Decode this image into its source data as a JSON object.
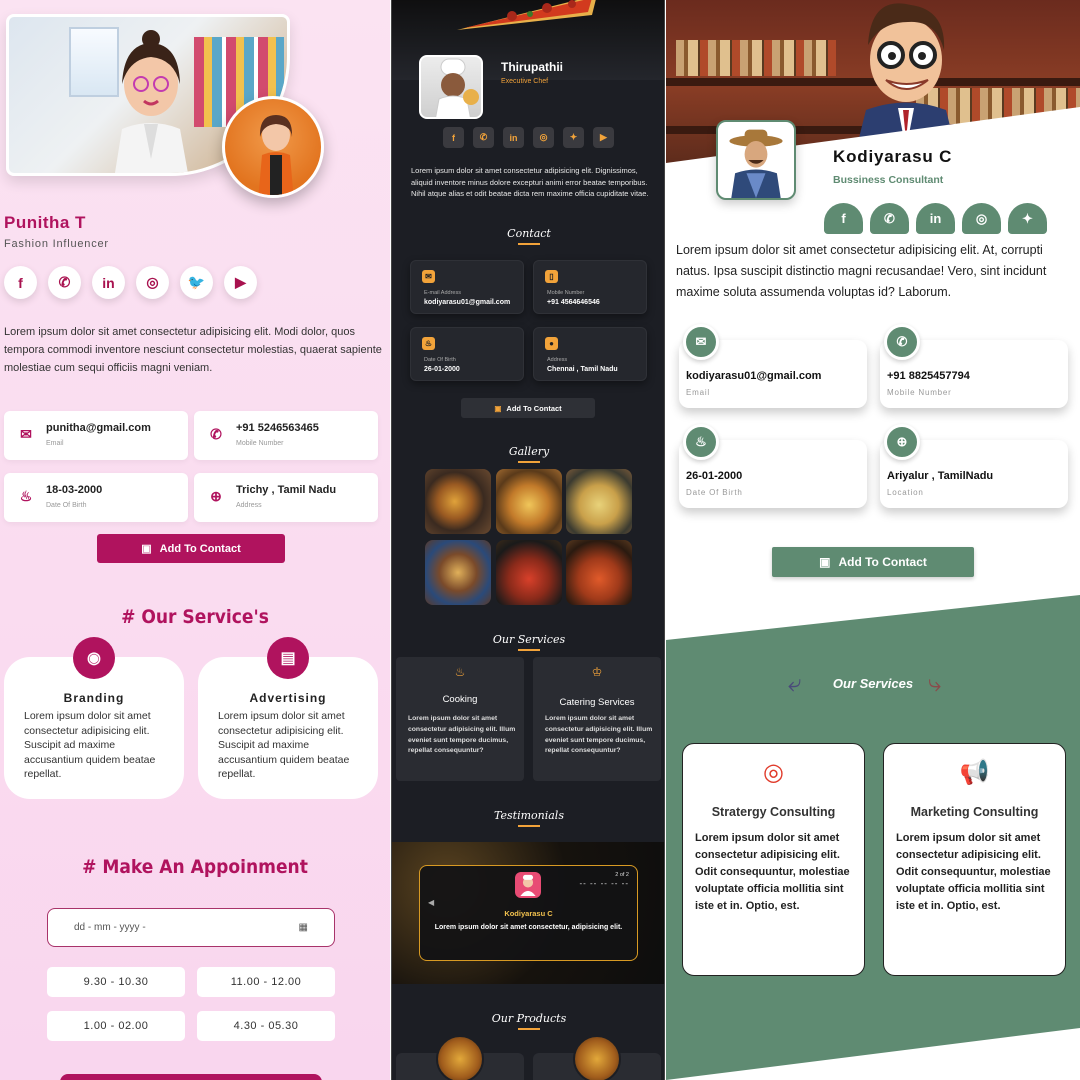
{
  "panel1": {
    "name": "Punitha T",
    "role": "Fashion Influencer",
    "socials": [
      "f",
      "whatsapp",
      "in",
      "instagram",
      "twitter",
      "youtube"
    ],
    "about": "Lorem ipsum dolor sit amet consectetur adipisicing elit. Modi dolor, quos tempora commodi inventore nesciunt consectetur molestias, quaerat sapiente molestiae cum sequi officiis magni veniam.",
    "contacts": [
      {
        "value": "punitha@gmail.com",
        "label": "Email",
        "icon": "mail-icon"
      },
      {
        "value": "+91 5246563465",
        "label": "Mobile Number",
        "icon": "phone-icon"
      },
      {
        "value": "18-03-2000",
        "label": "Date Of Birth",
        "icon": "cake-icon"
      },
      {
        "value": "Trichy , Tamil Nadu",
        "label": "Address",
        "icon": "location-icon"
      }
    ],
    "add_contact": "Add To Contact",
    "services_heading": "# Our Service's",
    "services": [
      {
        "title": "Branding",
        "desc": "Lorem ipsum dolor sit amet consectetur adipisicing elit. Suscipit ad maxime accusantium quidem beatae repellat."
      },
      {
        "title": "Advertising",
        "desc": "Lorem ipsum dolor sit amet consectetur adipisicing elit. Suscipit ad maxime accusantium quidem beatae repellat."
      }
    ],
    "appointment_heading": "# Make An Appoinment",
    "date_placeholder": "dd - mm - yyyy -",
    "slots": [
      "9.30 - 10.30",
      "11.00 - 12.00",
      "1.00 - 02.00",
      "4.30 - 05.30"
    ],
    "accent": "#b0135e"
  },
  "panel2": {
    "name": "Thirupathii",
    "role": "Executive Chef",
    "about": "Lorem ipsum dolor sit amet consectetur adipisicing elit. Dignissimos, aliquid inventore minus dolore excepturi animi error beatae temporibus. Nihil atque alias et odit beatae dicta rem maxime officia cupiditate vitae.",
    "contact_heading": "Contact",
    "contacts": [
      {
        "label": "E-mail Address",
        "value": "kodiyarasu01@gmail.com"
      },
      {
        "label": "Mobile Number",
        "value": "+91 4564646546"
      },
      {
        "label": "Date Of Birth",
        "value": "26-01-2000"
      },
      {
        "label": "Address",
        "value": "Chennai , Tamil Nadu"
      }
    ],
    "add_contact": "Add To Contact",
    "gallery_heading": "Gallery",
    "services_heading": "Our Services",
    "services": [
      {
        "title": "Cooking",
        "desc": "Lorem ipsum dolor sit amet consectetur adipisicing elit. Illum eveniet sunt tempore ducimus, repellat consequuntur?"
      },
      {
        "title": "Catering Services",
        "desc": "Lorem ipsum dolor sit amet consectetur adipisicing elit. Illum eveniet sunt tempore ducimus, repellat consequuntur?"
      }
    ],
    "testimonials_heading": "Testimonials",
    "testimonial": {
      "page": "2 of 2",
      "stars": "-- -- -- -- --",
      "name": "Kodiyarasu C",
      "quote": "Lorem ipsum dolor sit amet consectetur, adipisicing elit."
    },
    "products_heading": "Our Products",
    "accent": "#f2a33a"
  },
  "panel3": {
    "name": "Kodiyarasu C",
    "role": "Bussiness Consultant",
    "about": "Lorem ipsum dolor sit amet consectetur adipisicing elit. At, corrupti natus. Ipsa suscipit distinctio magni recusandae! Vero, sint incidunt maxime soluta assumenda voluptas id? Laborum.",
    "contacts": [
      {
        "value": "kodiyarasu01@gmail.com",
        "label": "Email"
      },
      {
        "value": "+91 8825457794",
        "label": "Mobile Number"
      },
      {
        "value": "26-01-2000",
        "label": "Date Of Birth"
      },
      {
        "value": "Ariyalur , TamilNadu",
        "label": "Location"
      }
    ],
    "add_contact": "Add To Contact",
    "services_heading": "Our Services",
    "services": [
      {
        "title": "Stratergy Consulting",
        "desc": "Lorem ipsum dolor sit amet consectetur adipisicing elit. Odit consequuntur, molestiae voluptate officia mollitia sint iste et in. Optio, est."
      },
      {
        "title": "Marketing Consulting",
        "desc": "Lorem ipsum dolor sit amet consectetur adipisicing elit. Odit consequuntur, molestiae voluptate officia mollitia sint iste et in. Optio, est."
      }
    ],
    "accent": "#5f8b72"
  }
}
